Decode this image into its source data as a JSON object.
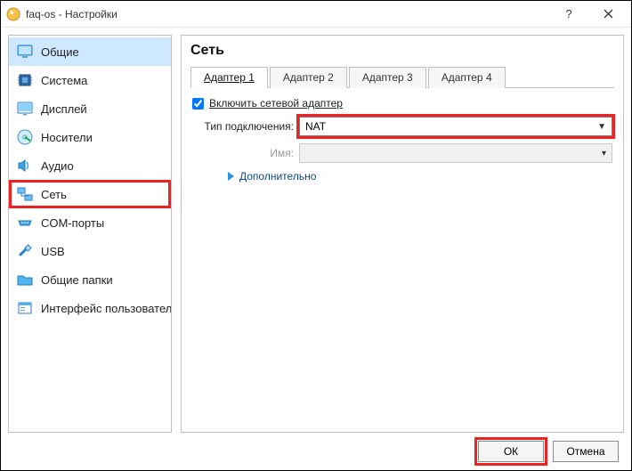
{
  "window": {
    "title": "faq-os - Настройки"
  },
  "sidebar": {
    "items": [
      {
        "id": "general",
        "label": "Общие",
        "icon": "monitor-icon"
      },
      {
        "id": "system",
        "label": "Система",
        "icon": "chip-icon"
      },
      {
        "id": "display",
        "label": "Дисплей",
        "icon": "screen-icon"
      },
      {
        "id": "storage",
        "label": "Носители",
        "icon": "disk-icon"
      },
      {
        "id": "audio",
        "label": "Аудио",
        "icon": "speaker-icon"
      },
      {
        "id": "network",
        "label": "Сеть",
        "icon": "network-icon"
      },
      {
        "id": "serial",
        "label": "COM-порты",
        "icon": "serial-icon"
      },
      {
        "id": "usb",
        "label": "USB",
        "icon": "usb-icon"
      },
      {
        "id": "shared",
        "label": "Общие папки",
        "icon": "folder-icon"
      },
      {
        "id": "ui",
        "label": "Интерфейс пользователя",
        "icon": "window-icon"
      }
    ],
    "selected_index": 5
  },
  "main": {
    "title": "Сеть",
    "tabs": [
      {
        "label": "Адаптер 1",
        "active": true
      },
      {
        "label": "Адаптер 2",
        "active": false
      },
      {
        "label": "Адаптер 3",
        "active": false
      },
      {
        "label": "Адаптер 4",
        "active": false
      }
    ],
    "adapter": {
      "enable_label": "Включить сетевой адаптер",
      "enable_checked": true,
      "attached_label": "Тип подключения:",
      "attached_value": "NAT",
      "name_label": "Имя:",
      "name_value": "",
      "advanced_label": "Дополнительно"
    }
  },
  "footer": {
    "ok": "ОК",
    "cancel": "Отмена"
  }
}
